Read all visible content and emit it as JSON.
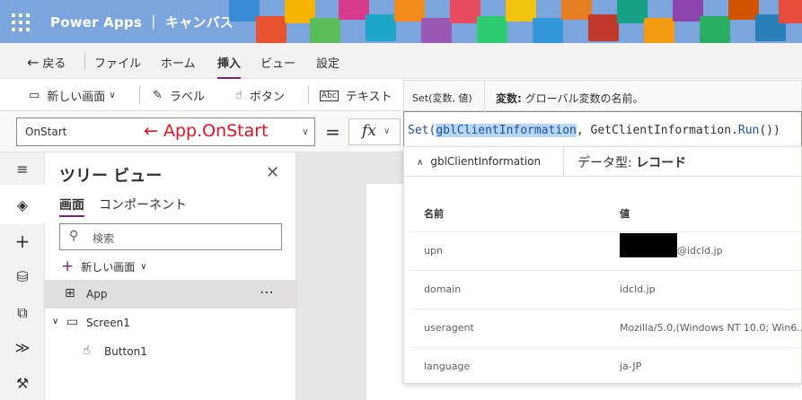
{
  "app": {
    "title": "Power Apps ｜ キャンバス"
  },
  "menu": {
    "back": "戻る",
    "items": [
      "ファイル",
      "ホーム",
      "挿入",
      "ビュー",
      "設定"
    ],
    "active": "挿入"
  },
  "toolbar": {
    "new_screen": "新しい画面",
    "label": "ラベル",
    "button": "ボタン",
    "text": "テキスト"
  },
  "formula_bar": {
    "property": "OnStart",
    "annotation": "← App.OnStart",
    "equals": "=",
    "fx": "fx",
    "formula_fn": "Set(",
    "formula_var": "gblClientInformation",
    "formula_mid": ", GetClientInformation.",
    "formula_run": "Run",
    "formula_end": "())"
  },
  "intellisense": {
    "signature": "Set(変数, 値)",
    "desc_bold": "変数:",
    "desc_text": " グローバル変数の名前。"
  },
  "result_panel": {
    "variable": "gblClientInformation",
    "type_label": "データ型:",
    "type_value": "レコード",
    "col_name": "名前",
    "col_value": "値",
    "rows": [
      {
        "name": "upn",
        "value": "@idcld.jp"
      },
      {
        "name": "domain",
        "value": "idcld.jp"
      },
      {
        "name": "useragent",
        "value": "Mozilla/5.0,(Windows NT 10.0; Win6..."
      },
      {
        "name": "language",
        "value": "ja-JP"
      }
    ]
  },
  "tree_view": {
    "title": "ツリー ビュー",
    "tabs": [
      "画面",
      "コンポーネント"
    ],
    "search_placeholder": "検索",
    "new_screen": "新しい画面",
    "items": [
      {
        "label": "App"
      },
      {
        "label": "Screen1"
      },
      {
        "label": "Button1"
      }
    ],
    "more": "⋯"
  },
  "colors": {
    "accent": "#742774",
    "titlebar": "#7ca4dd",
    "annotation": "#e81123"
  }
}
